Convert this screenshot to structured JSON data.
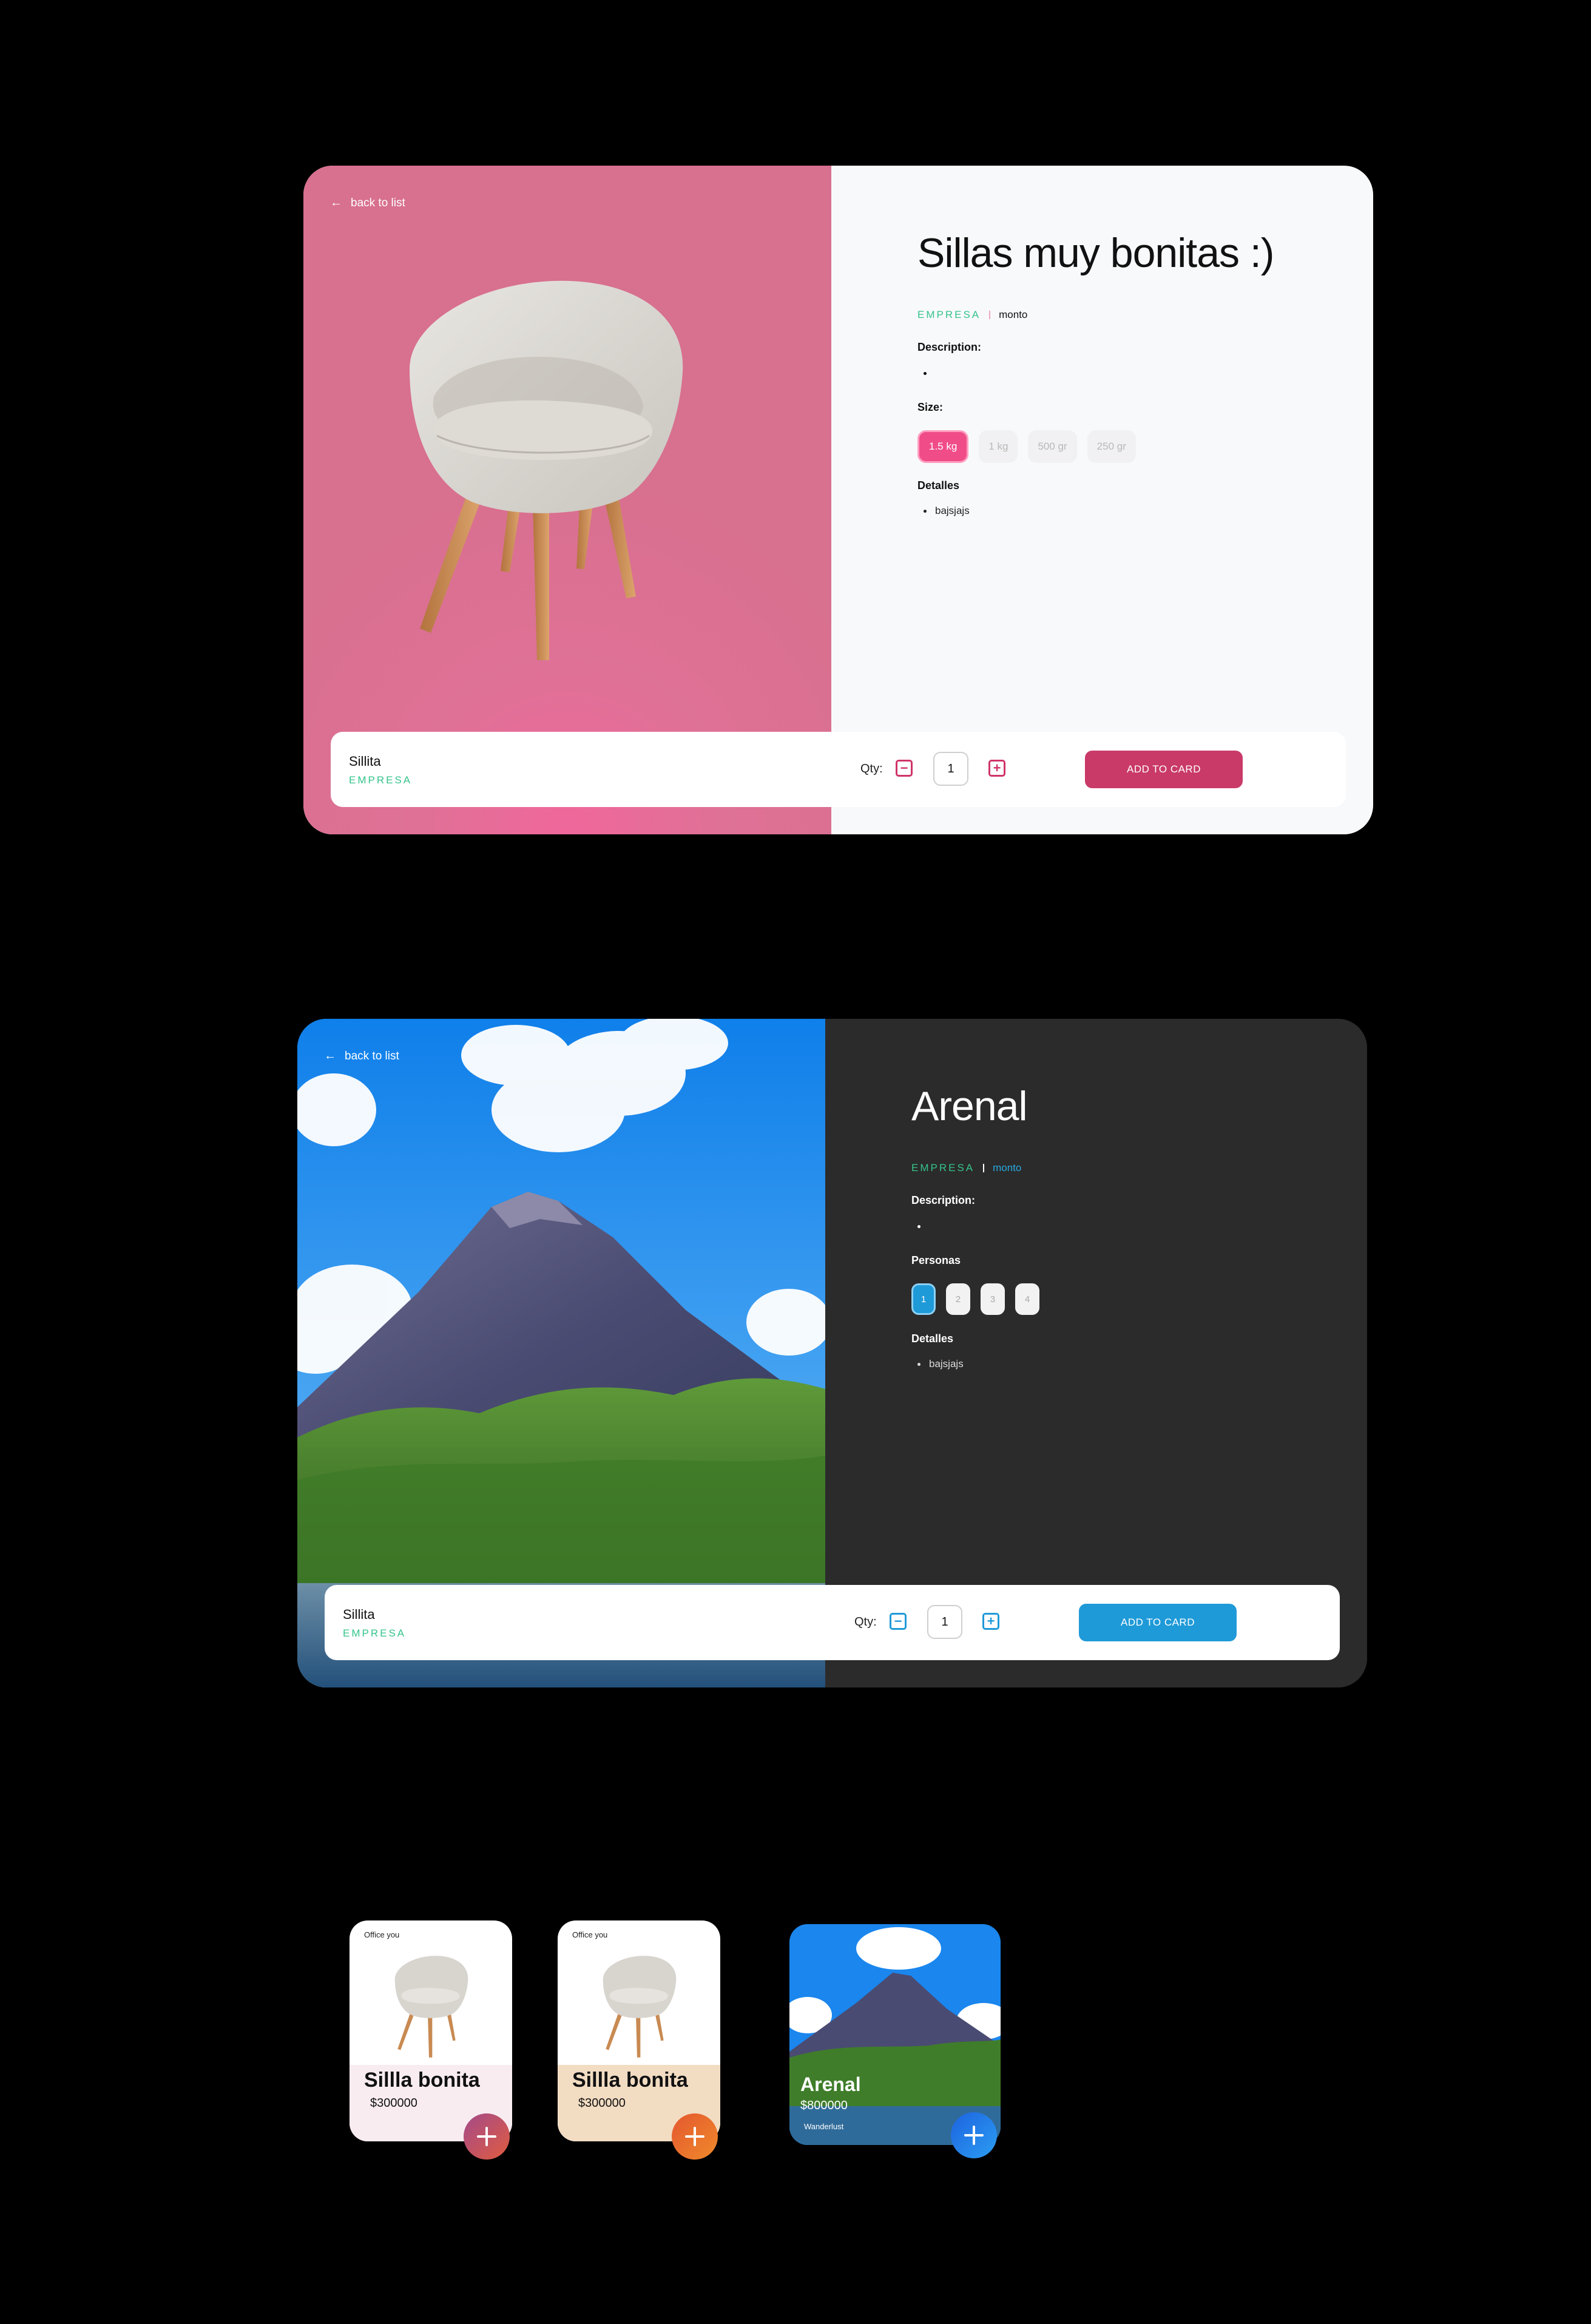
{
  "product_light": {
    "back_label": "back to list",
    "title": "Sillas muy bonitas :)",
    "brand": "EMPRESA",
    "amount": "monto",
    "description_label": "Description:",
    "size_label": "Size:",
    "sizes": [
      "1.5 kg",
      "1 kg",
      "500 gr",
      "250 gr"
    ],
    "selected_size": "1.5 kg",
    "details_label": "Detalles",
    "details": [
      "bajsjajs"
    ],
    "bar": {
      "product_name": "Sillita",
      "product_brand": "EMPRESA",
      "qty_label": "Qty:",
      "qty_value": "1",
      "add_label": "ADD TO CARD"
    },
    "accent": "#c93a69"
  },
  "product_dark": {
    "back_label": "back to list",
    "title": "Arenal",
    "brand": "EMPRESA",
    "amount": "monto",
    "description_label": "Description:",
    "people_label": "Personas",
    "people": [
      "1",
      "2",
      "3",
      "4"
    ],
    "selected_people": "1",
    "details_label": "Detalles",
    "details": [
      "bajsjajs"
    ],
    "bar": {
      "product_name": "Sillita",
      "product_brand": "EMPRESA",
      "qty_label": "Qty:",
      "qty_value": "1",
      "add_label": "ADD TO CARD"
    },
    "accent": "#1f9ad8"
  },
  "mini_cards": [
    {
      "brand": "Office you",
      "title": "Sillla bonita",
      "price": "$300000",
      "icon": "plus-icon",
      "band_color": "#f8ecf1",
      "button_color": "#c63f66"
    },
    {
      "brand": "Office you",
      "title": "Sillla bonita",
      "price": "$300000",
      "icon": "plus-icon",
      "band_color": "#f2dcc2",
      "button_color": "#e4572e"
    },
    {
      "title": "Arenal",
      "price": "$800000",
      "subtitle": "Wanderlust",
      "icon": "plus-icon",
      "button_color": "#1d63e0"
    }
  ]
}
